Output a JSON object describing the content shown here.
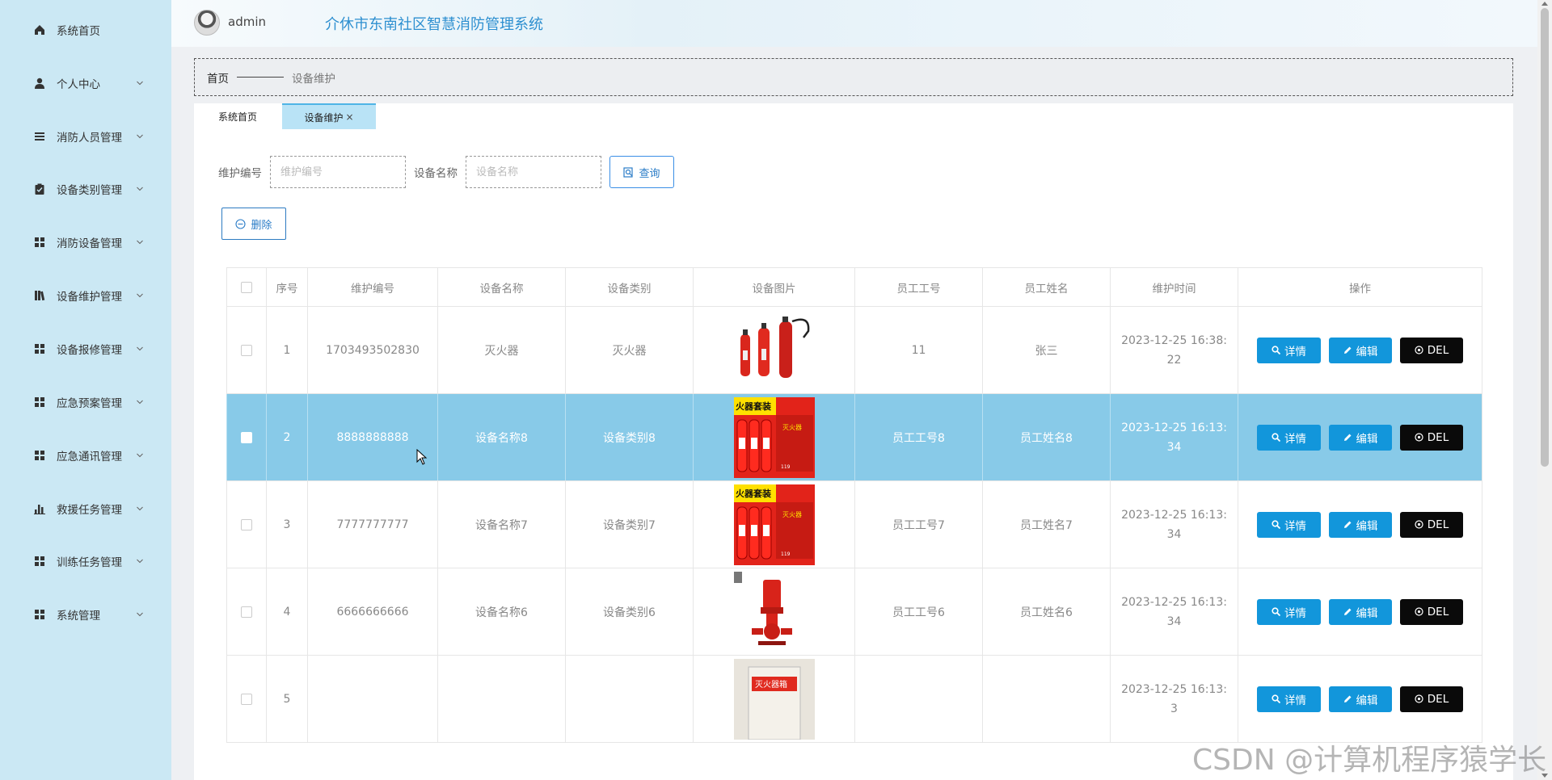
{
  "header": {
    "username": "admin",
    "system_title": "介休市东南社区智慧消防管理系统"
  },
  "sidebar": {
    "items": [
      {
        "label": "系统首页",
        "icon": "home-icon",
        "has_arrow": false
      },
      {
        "label": "个人中心",
        "icon": "user-icon",
        "has_arrow": true
      },
      {
        "label": "消防人员管理",
        "icon": "list-icon",
        "has_arrow": true
      },
      {
        "label": "设备类别管理",
        "icon": "clipboard-icon",
        "has_arrow": true
      },
      {
        "label": "消防设备管理",
        "icon": "grid-icon",
        "has_arrow": true
      },
      {
        "label": "设备维护管理",
        "icon": "book-icon",
        "has_arrow": true
      },
      {
        "label": "设备报修管理",
        "icon": "grid-icon",
        "has_arrow": true
      },
      {
        "label": "应急预案管理",
        "icon": "grid-icon",
        "has_arrow": true
      },
      {
        "label": "应急通讯管理",
        "icon": "grid-icon",
        "has_arrow": true
      },
      {
        "label": "救援任务管理",
        "icon": "bar-chart-icon",
        "has_arrow": true
      },
      {
        "label": "训练任务管理",
        "icon": "grid-icon",
        "has_arrow": true
      },
      {
        "label": "系统管理",
        "icon": "grid-icon",
        "has_arrow": true
      }
    ]
  },
  "breadcrumb": {
    "home": "首页",
    "current": "设备维护"
  },
  "tabs": {
    "home": "系统首页",
    "active": "设备维护",
    "close": "×"
  },
  "search": {
    "field1_label": "维护编号",
    "field1_placeholder": "维护编号",
    "field2_label": "设备名称",
    "field2_placeholder": "设备名称",
    "query_label": "查询"
  },
  "batch_delete_label": "删除",
  "table": {
    "columns": [
      "序号",
      "维护编号",
      "设备名称",
      "设备类别",
      "设备图片",
      "员工工号",
      "员工姓名",
      "维护时间",
      "操作"
    ],
    "actions": {
      "detail": "详情",
      "edit": "编辑",
      "delete": "DEL"
    },
    "rows": [
      {
        "index": "1",
        "code": "1703493502830",
        "name": "灭火器",
        "category": "灭火器",
        "image": "fire-extinguishers-image",
        "emp_no": "11",
        "emp_name": "张三",
        "time": "2023-12-25 16:38:22",
        "selected": false
      },
      {
        "index": "2",
        "code": "8888888888",
        "name": "设备名称8",
        "category": "设备类别8",
        "image": "extinguisher-kit-image",
        "emp_no": "员工工号8",
        "emp_name": "员工姓名8",
        "time": "2023-12-25 16:13:34",
        "selected": true
      },
      {
        "index": "3",
        "code": "7777777777",
        "name": "设备名称7",
        "category": "设备类别7",
        "image": "extinguisher-kit-image",
        "emp_no": "员工工号7",
        "emp_name": "员工姓名7",
        "time": "2023-12-25 16:13:34",
        "selected": false
      },
      {
        "index": "4",
        "code": "6666666666",
        "name": "设备名称6",
        "category": "设备类别6",
        "image": "fire-pump-image",
        "emp_no": "员工工号6",
        "emp_name": "员工姓名6",
        "time": "2023-12-25 16:13:34",
        "selected": false
      },
      {
        "index": "5",
        "code": "",
        "name": "",
        "category": "",
        "image": "extinguisher-box-image",
        "emp_no": "",
        "emp_name": "",
        "time": "2023-12-25 16:13:3",
        "selected": false
      }
    ]
  },
  "image_text": {
    "kit_label": "灭火器套装",
    "box_label": "灭火器箱"
  },
  "watermark": "CSDN @计算机程序猿学长",
  "colors": {
    "sidebar_bg": "#cbe8f4",
    "accent": "#1296db",
    "selected_row": "#88cae8",
    "title": "#2d8fd0"
  }
}
